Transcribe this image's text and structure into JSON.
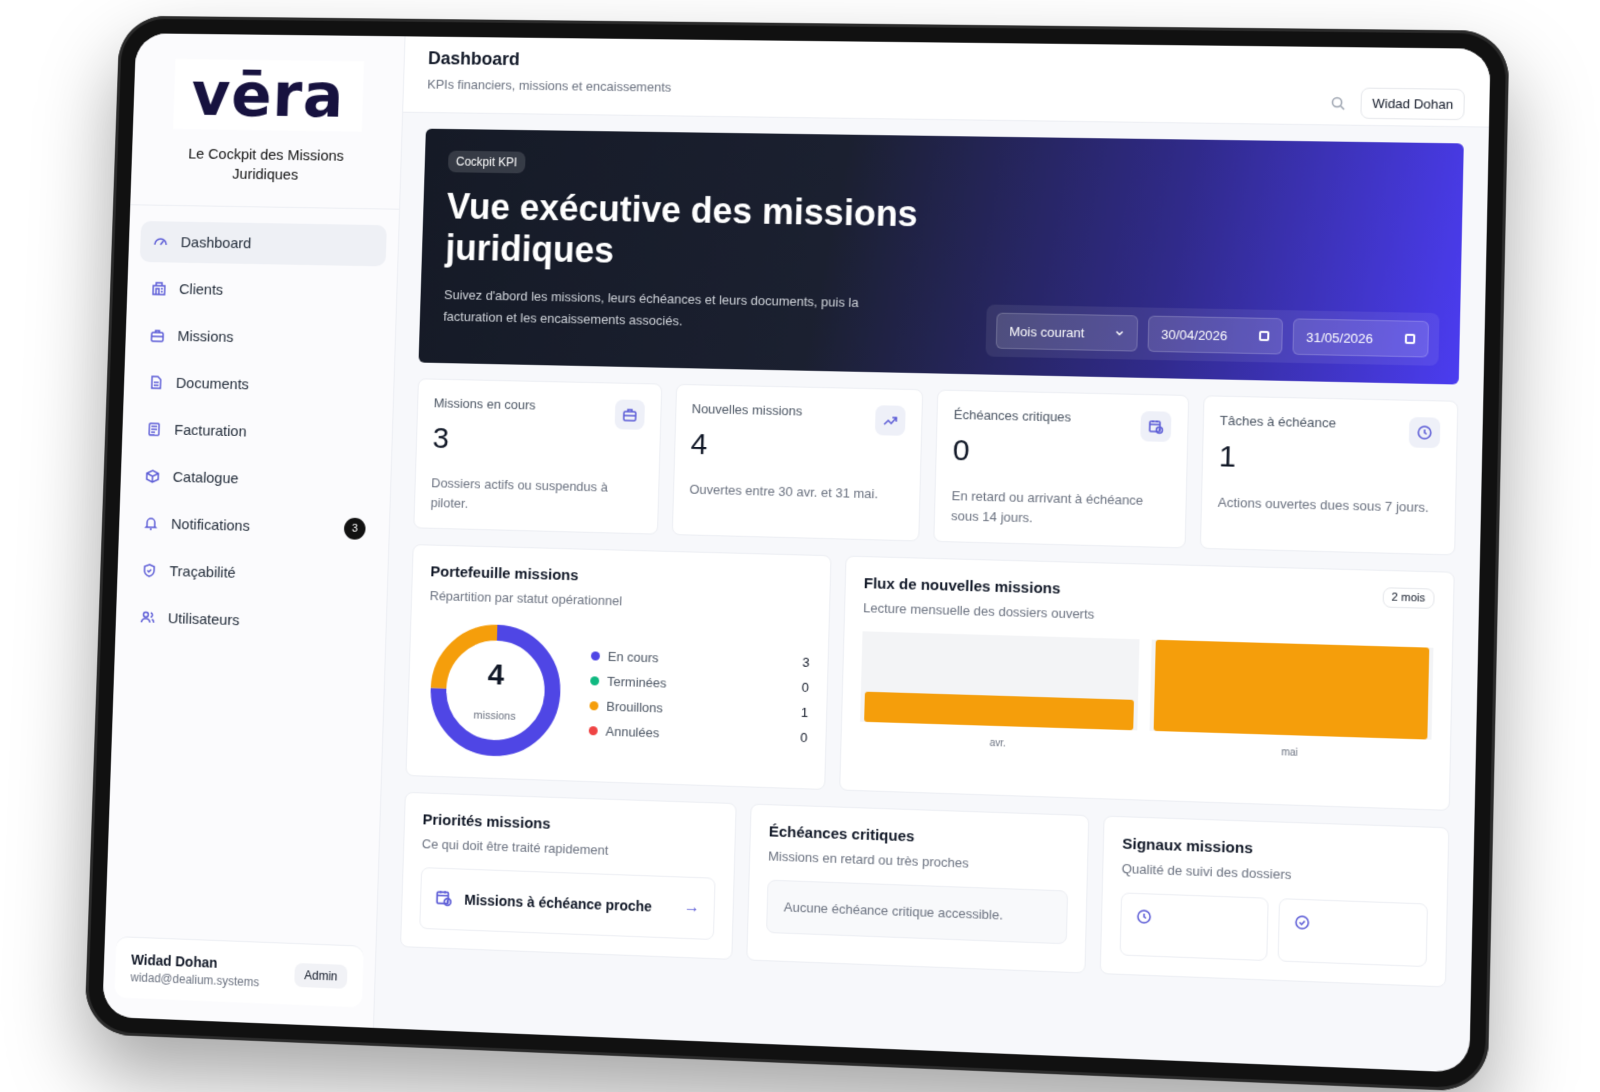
{
  "brand": {
    "logo": "vēra",
    "tagline": "Le Cockpit des Missions Juridiques"
  },
  "nav": [
    {
      "label": "Dashboard",
      "icon": "gauge-icon"
    },
    {
      "label": "Clients",
      "icon": "building-icon"
    },
    {
      "label": "Missions",
      "icon": "briefcase-icon"
    },
    {
      "label": "Documents",
      "icon": "document-icon"
    },
    {
      "label": "Facturation",
      "icon": "invoice-icon"
    },
    {
      "label": "Catalogue",
      "icon": "box-icon"
    },
    {
      "label": "Notifications",
      "icon": "bell-icon",
      "badge": "3"
    },
    {
      "label": "Traçabilité",
      "icon": "shield-check-icon"
    },
    {
      "label": "Utilisateurs",
      "icon": "users-icon"
    }
  ],
  "user": {
    "name": "Widad Dohan",
    "email": "widad@dealium.systems",
    "role": "Admin"
  },
  "header": {
    "title": "Dashboard",
    "subtitle": "KPIs financiers, missions et encaissements",
    "user_button": "Widad Dohan"
  },
  "hero": {
    "tag": "Cockpit KPI",
    "title": "Vue exécutive des missions juridiques",
    "description": "Suivez d'abord les missions, leurs échéances et leurs documents, puis la facturation et les encaissements associés.",
    "period": "Mois courant",
    "date_from": "30/04/2026",
    "date_to": "31/05/2026"
  },
  "kpis": [
    {
      "label": "Missions en cours",
      "value": "3",
      "desc": "Dossiers actifs ou suspendus à piloter.",
      "icon": "briefcase-icon"
    },
    {
      "label": "Nouvelles missions",
      "value": "4",
      "desc": "Ouvertes entre 30 avr. et 31 mai.",
      "icon": "trend-up-icon"
    },
    {
      "label": "Échéances critiques",
      "value": "0",
      "desc": "En retard ou arrivant à échéance sous 14 jours.",
      "icon": "calendar-clock-icon"
    },
    {
      "label": "Tâches à échéance",
      "value": "1",
      "desc": "Actions ouvertes dues sous 7 jours.",
      "icon": "clock-icon"
    }
  ],
  "portfolio": {
    "title": "Portefeuille missions",
    "subtitle": "Répartition par statut opérationnel",
    "total": "4",
    "unit": "missions",
    "statuses": [
      {
        "label": "En cours",
        "value": 3,
        "color": "#4f46e5"
      },
      {
        "label": "Terminées",
        "value": 0,
        "color": "#10b981"
      },
      {
        "label": "Brouillons",
        "value": 1,
        "color": "#f59e0b"
      },
      {
        "label": "Annulées",
        "value": 0,
        "color": "#ef4444"
      }
    ]
  },
  "flux": {
    "title": "Flux de nouvelles missions",
    "subtitle": "Lecture mensuelle des dossiers ouverts",
    "badge": "2 mois"
  },
  "chart_data": {
    "type": "bar",
    "categories": [
      "avr.",
      "mai"
    ],
    "values": [
      1,
      3
    ],
    "ylim": [
      0,
      3
    ],
    "bar_color": "#f59e0b",
    "track_color": "#f3f4f6",
    "grid": false
  },
  "priorities": {
    "title": "Priorités missions",
    "subtitle": "Ce qui doit être traité rapidement",
    "item": "Missions à échéance proche"
  },
  "deadlines": {
    "title": "Échéances critiques",
    "subtitle": "Missions en retard ou très proches",
    "empty": "Aucune échéance critique accessible."
  },
  "signals": {
    "title": "Signaux missions",
    "subtitle": "Qualité de suivi des dossiers"
  }
}
